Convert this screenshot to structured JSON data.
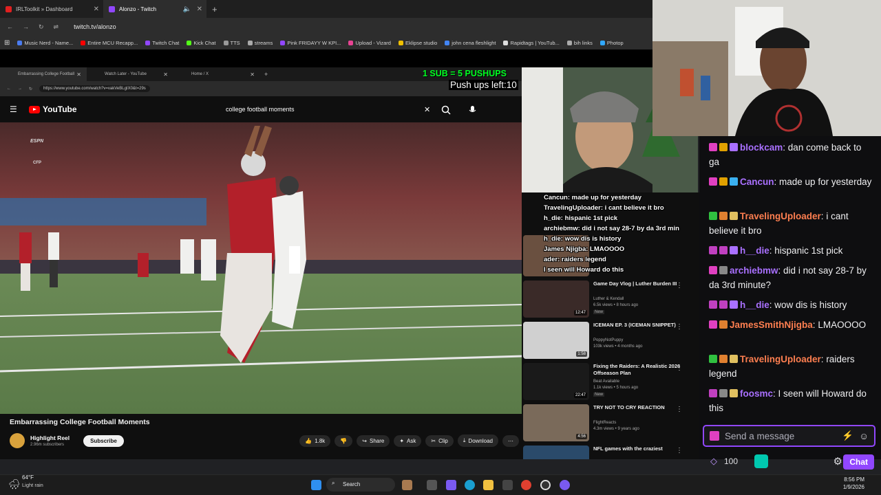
{
  "browser": {
    "tabs": [
      {
        "label": "IRLToolkit » Dashboard",
        "color": "#e02020"
      },
      {
        "label": "Alonzo - Twitch",
        "color": "#9147ff"
      }
    ],
    "url": "twitch.tv/alonzo",
    "bookmarks": [
      {
        "label": "Music Nerd - Name...",
        "color": "#4a7cf0"
      },
      {
        "label": "Entire MCU Recapp...",
        "color": "#ff0000"
      },
      {
        "label": "Twitch Chat",
        "color": "#9147ff"
      },
      {
        "label": "Kick Chat",
        "color": "#53fc18"
      },
      {
        "label": "TTS",
        "color": "#999999"
      },
      {
        "label": "streams",
        "color": "#aaaaaa"
      },
      {
        "label": "Pink FRIDAYY W KPI...",
        "color": "#9147ff"
      },
      {
        "label": "Upload - Vizard",
        "color": "#e84393"
      },
      {
        "label": "Eklipse studio",
        "color": "#f0c000"
      },
      {
        "label": "john cena fleshlight",
        "color": "#4285f4"
      },
      {
        "label": "Rapidtags | YouTub...",
        "color": "#dddddd"
      },
      {
        "label": "bih links",
        "color": "#aaaaaa"
      },
      {
        "label": "Photop",
        "color": "#31a8ff"
      }
    ]
  },
  "inner": {
    "tabs": [
      "Embarrassing College Football",
      "Watch Later - YouTube",
      "Home / X"
    ],
    "url": "https://www.youtube.com/watch?v=vakVeBLgIX0&t=29s",
    "yt_logo": "YouTube",
    "search_query": "college football moments",
    "video_title": "Embarrassing College Football Moments",
    "channel": "Highlight Reel",
    "subscribers": "2.96m subscribers",
    "subscribe": "Subscribe",
    "likes": "1.8k",
    "share": "Share",
    "ask": "Ask",
    "clip": "Clip",
    "download": "Download",
    "espn": "ESPN",
    "cfp": "CFP"
  },
  "overlay": {
    "pushups_rule": "1 SUB = 5 PUSHUPS",
    "pushups_left": "Push ups left:10",
    "chat_lines": [
      "Cancun: made up for yesterday",
      "TravelingUploader: i cant believe it bro",
      "h_die: hispanic 1st pick",
      "archiebmw: did i not say 28-7 by da 3rd min",
      "h_die: wow dis is history",
      "James Njigba: LMAOOOO",
      "ader: raiders legend",
      "I seen will Howard do this"
    ]
  },
  "sidebar": [
    {
      "title": "Game Day Vlog | Luther Burden III",
      "meta1": "Luther & Kendall",
      "meta2": "6.5k views • 8 hours ago",
      "badge": "New",
      "duration": "12:47"
    },
    {
      "title": "ICEMAN EP. 3 (ICEMAN SNIPPET)",
      "meta1": "PoppyNotPuppy",
      "meta2": "103k views • 4 months ago",
      "badge": "",
      "duration": "1:58"
    },
    {
      "title": "Fixing the Raiders: A Realistic 2026 Offseason Plan",
      "meta1": "Beat Available",
      "meta2": "1.1k views • 5 hours ago",
      "badge": "New",
      "duration": "22:47"
    },
    {
      "title": "TRY NOT TO CRY REACTION",
      "meta1": "FlightReacts",
      "meta2": "4.3m views • 9 years ago",
      "badge": "",
      "duration": "4:56"
    },
    {
      "title": "NFL games with the craziest",
      "meta1": "",
      "meta2": "",
      "badge": "",
      "duration": ""
    }
  ],
  "chat": {
    "messages": [
      {
        "user": "blockcam",
        "text": "dan come back to ga",
        "color": "#a970ff"
      },
      {
        "user": "Cancun",
        "text": "made up for yesterday",
        "color": "#a970ff"
      },
      {
        "user": "TravelingUploader",
        "text": "i cant believe it bro",
        "color": "#ff7f50"
      },
      {
        "user": "h__die",
        "text": "hispanic 1st pick",
        "color": "#a970ff"
      },
      {
        "user": "archiebmw",
        "text": "did i not say 28-7 by da 3rd minute?",
        "color": "#a970ff"
      },
      {
        "user": "h__die",
        "text": "wow dis is history",
        "color": "#a970ff"
      },
      {
        "user": "JamesSmithNjigba",
        "text": "LMAOOOO",
        "color": "#ff7f50"
      },
      {
        "user": "TravelingUploader",
        "text": "raiders legend",
        "color": "#ff7f50"
      },
      {
        "user": "foosmc",
        "text": "I seen will Howard do this",
        "color": "#a970ff"
      }
    ],
    "placeholder": "Send a message",
    "points": "100",
    "chat_button": "Chat"
  },
  "taskbar": {
    "temp": "64°F",
    "weather": "Light rain",
    "search": "Search",
    "time": "8:56 PM",
    "date": "1/9/2026"
  }
}
